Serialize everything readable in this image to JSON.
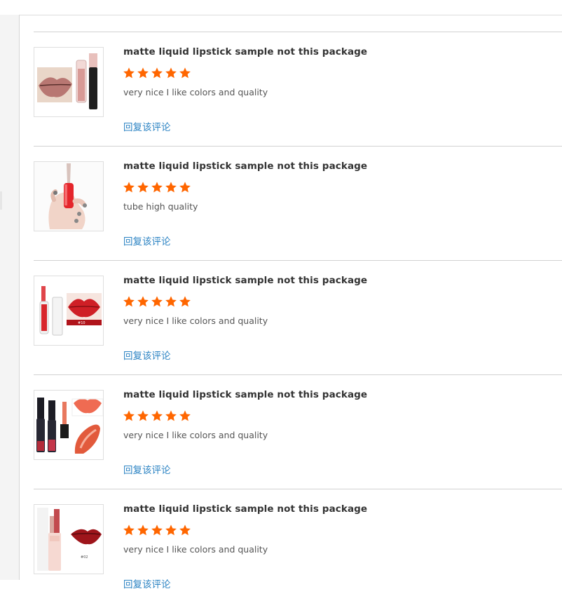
{
  "colors": {
    "star": "#ff6600",
    "link": "#2b83c3",
    "title": "#333333",
    "text": "#555555"
  },
  "reviews": [
    {
      "title": "matte liquid lipstick sample not this package",
      "rating": 5,
      "comment": "very nice I like colors and quality",
      "reply": "回复该评论",
      "thumb_icon": "nude-lipstick-photo"
    },
    {
      "title": "matte liquid lipstick sample not this package",
      "rating": 5,
      "comment": "tube high quality",
      "reply": "回复该评论",
      "thumb_icon": "hand-holding-lipstick-photo"
    },
    {
      "title": "matte liquid lipstick sample not this package",
      "rating": 5,
      "comment": "very nice I like colors and quality",
      "reply": "回复该评论",
      "thumb_icon": "red-lips-swatch-photo"
    },
    {
      "title": "matte liquid lipstick sample not this package",
      "rating": 5,
      "comment": "very nice I like colors and quality",
      "reply": "回复该评论",
      "thumb_icon": "black-tubes-coral-lips-photo"
    },
    {
      "title": "matte liquid lipstick sample not this package",
      "rating": 5,
      "comment": "very nice I like colors and quality",
      "reply": "回复该评论",
      "thumb_icon": "pink-tube-dark-lips-photo"
    }
  ]
}
